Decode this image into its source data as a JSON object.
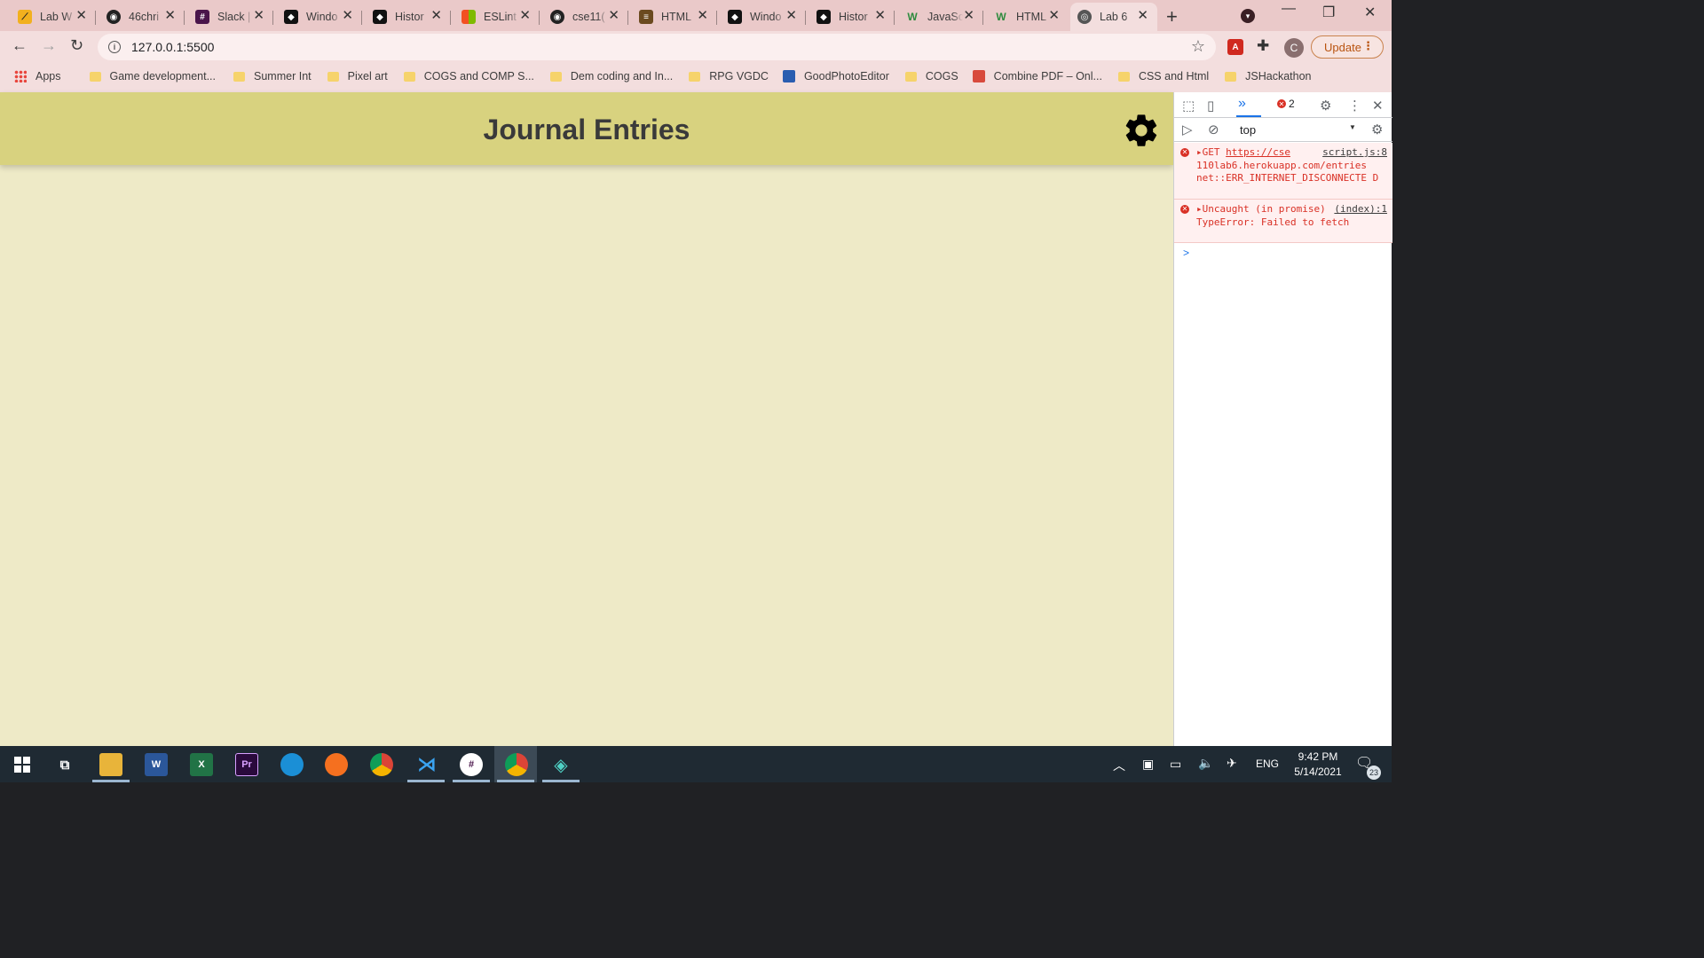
{
  "browser": {
    "tabs": [
      {
        "title": "Lab W",
        "icon": "zigzag-icon",
        "color": "#f2b01e"
      },
      {
        "title": "46chri",
        "icon": "github-icon",
        "color": "#222222"
      },
      {
        "title": "Slack |",
        "icon": "slack-icon",
        "color": "#4a154b"
      },
      {
        "title": "Windo",
        "icon": "canvas-icon",
        "color": "#111111"
      },
      {
        "title": "Histor",
        "icon": "canvas-icon",
        "color": "#111111"
      },
      {
        "title": "ESLint",
        "icon": "microsoft-icon",
        "color": "#00a4ef"
      },
      {
        "title": "cse11(",
        "icon": "github-icon",
        "color": "#222222"
      },
      {
        "title": "HTML",
        "icon": "stack-overflow-icon",
        "color": "#6b4a1f"
      },
      {
        "title": "Windo",
        "icon": "canvas-icon",
        "color": "#111111"
      },
      {
        "title": "Histor",
        "icon": "canvas-icon",
        "color": "#111111"
      },
      {
        "title": "JavaSc",
        "icon": "w3schools-icon",
        "color": "#2e8b3e"
      },
      {
        "title": "HTML",
        "icon": "w3schools-icon",
        "color": "#2e8b3e"
      },
      {
        "title": "Lab 6",
        "icon": "globe-icon",
        "color": "#555555",
        "active": true
      }
    ],
    "new_tab": "+",
    "url": "127.0.0.1:5500",
    "update_label": "Update",
    "profile_initial": "C",
    "bookmarks": [
      {
        "label": "Apps",
        "type": "apps"
      },
      {
        "label": "Game development...",
        "type": "folder"
      },
      {
        "label": "Summer Int",
        "type": "folder"
      },
      {
        "label": "Pixel art",
        "type": "folder"
      },
      {
        "label": "COGS and COMP S...",
        "type": "folder"
      },
      {
        "label": "Dem coding and In...",
        "type": "folder"
      },
      {
        "label": "RPG VGDC",
        "type": "folder"
      },
      {
        "label": "GoodPhotoEditor",
        "type": "site",
        "color": "#2a5db0"
      },
      {
        "label": "COGS",
        "type": "folder"
      },
      {
        "label": "Combine PDF – Onl...",
        "type": "site",
        "color": "#d84a3c"
      },
      {
        "label": "CSS and Html",
        "type": "folder"
      },
      {
        "label": "JSHackathon",
        "type": "folder"
      }
    ]
  },
  "page": {
    "title": "Journal Entries",
    "settings_icon": "gear-icon",
    "background": "#eeeac7",
    "header_color": "#d8d27f"
  },
  "devtools": {
    "error_count": "2",
    "context": "top",
    "messages": [
      {
        "prefix": "GET",
        "link": "https://cse",
        "source": "script.js:8",
        "rest": "110lab6.herokuapp.com/entries net::ERR_INTERNET_DISCONNECTE D"
      },
      {
        "prefix": "Uncaught (in",
        "source": "(index):1",
        "rest": "promise) TypeError: Failed to fetch"
      }
    ],
    "prompt": ">"
  },
  "taskbar": {
    "apps": [
      {
        "name": "task-view",
        "label": ""
      },
      {
        "name": "file-explorer",
        "label": ""
      },
      {
        "name": "word",
        "label": "W"
      },
      {
        "name": "excel",
        "label": "X"
      },
      {
        "name": "premiere",
        "label": "Pr"
      },
      {
        "name": "edge",
        "label": ""
      },
      {
        "name": "firefox",
        "label": ""
      },
      {
        "name": "chrome",
        "label": ""
      },
      {
        "name": "vscode",
        "label": ""
      },
      {
        "name": "slack",
        "label": ""
      },
      {
        "name": "chrome-active",
        "label": ""
      },
      {
        "name": "git-kraken",
        "label": ""
      }
    ],
    "language": "ENG",
    "time": "9:42 PM",
    "date": "5/14/2021",
    "notifications": "23"
  }
}
